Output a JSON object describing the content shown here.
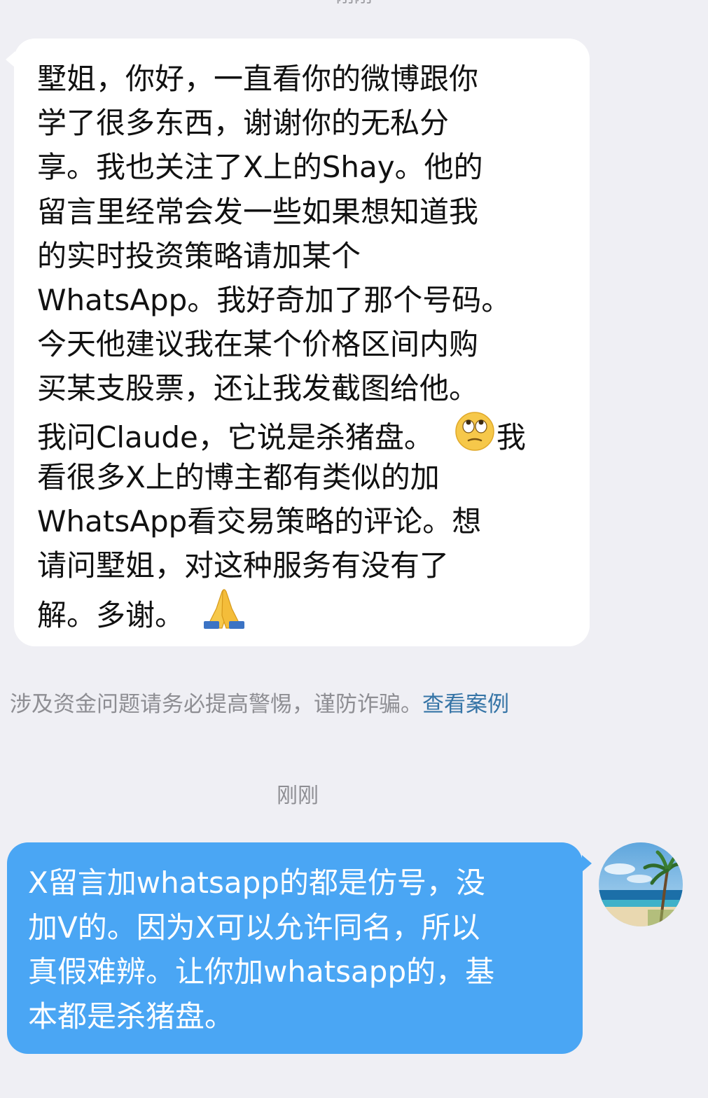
{
  "header": {
    "partial_timestamp": "刚刚"
  },
  "incoming_message": {
    "lines": [
      "墅姐，你好，一直看你的微博跟你",
      "学了很多东西，谢谢你的无私分",
      "享。我也关注了X上的Shay。他的",
      "留言里经常会发一些如果想知道我",
      "的实时投资策略请加某个",
      " WhatsApp。我好奇加了那个号码。",
      "今天他建议我在某个价格区间内购",
      "买某支股票，还让我发截图给他。",
      "我问Claude，它说是杀猪盘。",
      "我",
      "看很多X上的博主都有类似的加",
      " WhatsApp看交易策略的评论。想",
      "请问墅姐，对这种服务有没有了",
      "解。多谢。"
    ],
    "emoji_1": "face-with-rolling-eyes-icon",
    "emoji_2": "folded-hands-icon"
  },
  "safety_notice": {
    "text": "涉及资金问题请务必提高警惕，谨防诈骗。",
    "link_label": "查看案例"
  },
  "timestamp": "刚刚",
  "outgoing_message": {
    "lines": [
      "X留言加whatsapp的都是仿号，没",
      "加V的。因为X可以允许同名，所以",
      "真假难辨。让你加whatsapp的，基",
      "本都是杀猪盘。"
    ]
  },
  "avatar": {
    "icon": "beach-palm-avatar-icon"
  },
  "colors": {
    "background": "#efeff4",
    "incoming_bubble": "#ffffff",
    "outgoing_bubble": "#4aa6f4",
    "link": "#3574a6",
    "muted_text": "#8e8e93"
  }
}
